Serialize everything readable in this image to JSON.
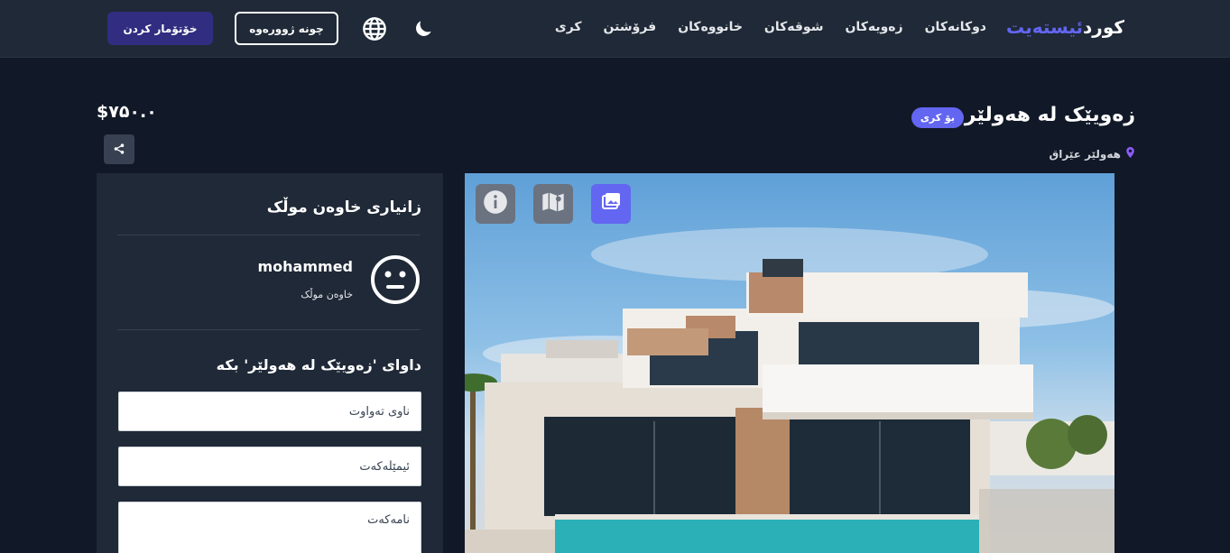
{
  "nav": {
    "logo_part1": "کورد",
    "logo_part2": "ئیستەیت",
    "links": [
      "کری",
      "فرۆشتن",
      "خانووەکان",
      "شوقەکان",
      "زەویەکان",
      "دوکانەکان"
    ],
    "login_label": "چونە ژوورەوە",
    "register_label": "خۆتۆمار کردن"
  },
  "listing": {
    "title": "زەویێک لە هەولێر",
    "badge": "بۆ کری",
    "location": "هەولێر عێراق",
    "price": "$۷۵٠.٠"
  },
  "gallery": {
    "tabs": [
      {
        "name": "info",
        "icon": "info-icon",
        "active": false
      },
      {
        "name": "map",
        "icon": "map-icon",
        "active": false
      },
      {
        "name": "photos",
        "icon": "image-icon",
        "active": true
      }
    ]
  },
  "owner_panel": {
    "heading": "زانیاری خاوەن موڵک",
    "name": "mohammed",
    "role": "خاوەن موڵک",
    "avatar_icon": "neutral-face-icon"
  },
  "request_form": {
    "heading": "داوای 'زەویێک لە هەولێر' بکە",
    "name_placeholder": "ناوی تەواوت",
    "email_placeholder": "ئیمێڵەکەت",
    "message_placeholder": "نامەکەت"
  },
  "colors": {
    "accent": "#6366f1",
    "nav_bg": "#1f2937",
    "page_bg": "#111827",
    "register_btn": "#312e81"
  }
}
